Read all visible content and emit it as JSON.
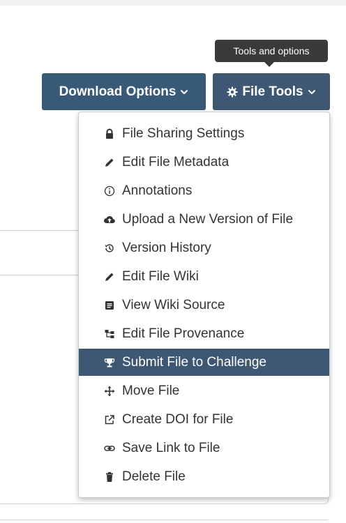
{
  "tooltip": {
    "text": "Tools and options"
  },
  "toolbar": {
    "download_label": "Download Options",
    "file_tools_label": "File Tools"
  },
  "menu": {
    "items": [
      {
        "label": "File Sharing Settings",
        "icon": "lock-icon"
      },
      {
        "label": "Edit File Metadata",
        "icon": "pencil-icon"
      },
      {
        "label": "Annotations",
        "icon": "info-icon"
      },
      {
        "label": "Upload a New Version of File",
        "icon": "cloud-upload-icon"
      },
      {
        "label": "Version History",
        "icon": "history-icon"
      },
      {
        "label": "Edit File Wiki",
        "icon": "pencil-icon"
      },
      {
        "label": "View Wiki Source",
        "icon": "document-icon"
      },
      {
        "label": "Edit File Provenance",
        "icon": "provenance-icon"
      },
      {
        "label": "Submit File to Challenge",
        "icon": "trophy-icon",
        "active": true
      },
      {
        "label": "Move File",
        "icon": "move-icon"
      },
      {
        "label": "Create DOI for File",
        "icon": "external-link-icon"
      },
      {
        "label": "Save Link to File",
        "icon": "link-icon"
      },
      {
        "label": "Delete File",
        "icon": "trash-icon"
      }
    ]
  },
  "colors": {
    "button_bg": "#395979",
    "active_bg": "#3e5773",
    "tooltip_bg": "#3a3a3a"
  }
}
